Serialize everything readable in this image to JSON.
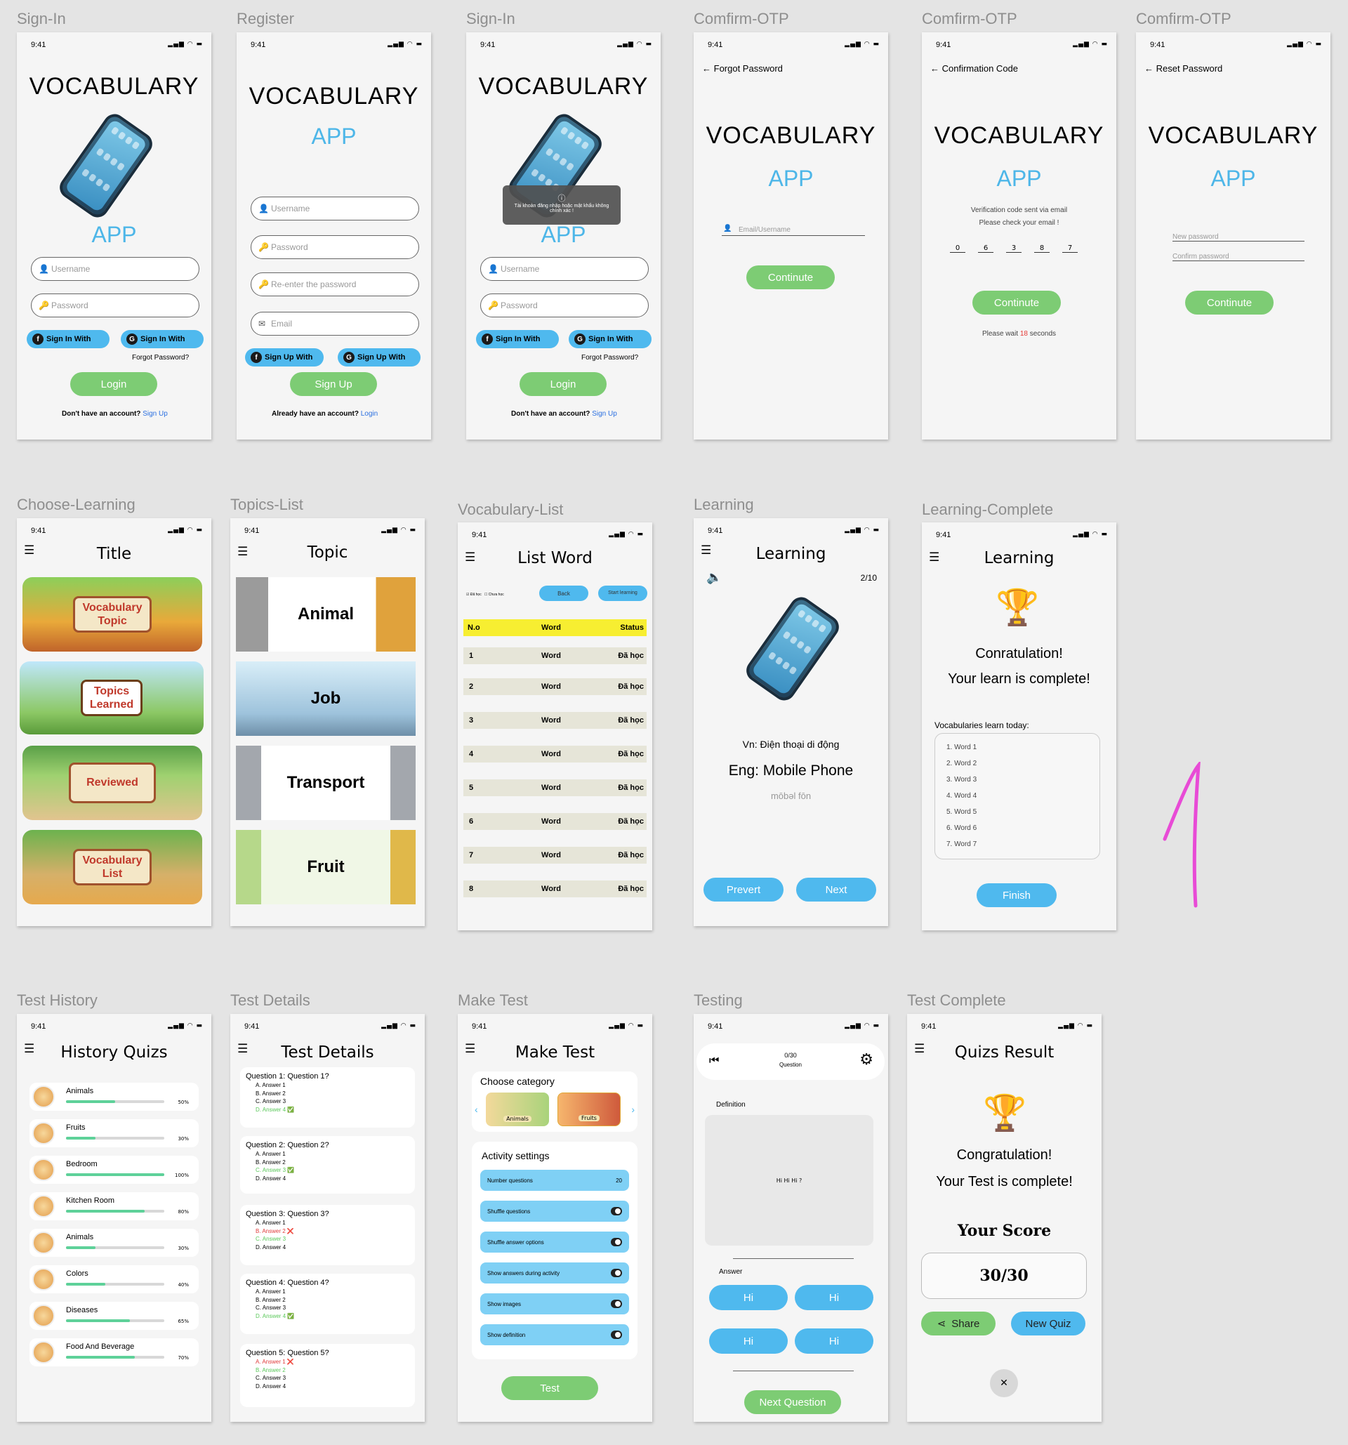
{
  "labels": {
    "s1": "Sign-In",
    "s2": "Register",
    "s3": "Sign-In",
    "s4": "Comfirm-OTP",
    "s5": "Comfirm-OTP",
    "s6": "Comfirm-OTP",
    "s7": "Choose-Learning",
    "s8": "Topics-List",
    "s9": "Vocabulary-List",
    "s10": "Learning",
    "s11": "Learning-Complete",
    "s12": "Test History",
    "s13": "Test Details",
    "s14": "Make Test",
    "s15": "Testing",
    "s16": "Test Complete"
  },
  "common": {
    "time": "9:41",
    "signal": "▂▄▆ ◠ ▬",
    "vocab": "VOCABULARY",
    "app": "APP",
    "username": "Username",
    "password": "Password",
    "sign_in_with": "Sign In With",
    "sign_up_with": "Sign Up With",
    "forgot": "Forgot Password?",
    "login": "Login",
    "sign_up": "Sign Up",
    "no_account": "Don't have an account?",
    "have_account": "Already have an account?",
    "reenter": "Re-enter the password",
    "email": "Email",
    "continue": "Continute"
  },
  "signin_error": "Tài khoản đăng nhập hoặc mật khẩu không chính xác !",
  "otp1": {
    "title": "Forgot Password",
    "field": "Email/Username"
  },
  "otp2": {
    "title": "Confirmation Code",
    "msg1": "Verification code sent via email",
    "msg2": "Please check your email !",
    "digits": [
      "0",
      "6",
      "3",
      "8",
      "7"
    ],
    "wait_a": "Please wait",
    "wait_n": "18",
    "wait_b": "seconds"
  },
  "otp3": {
    "title": "Reset Password",
    "new": "New password",
    "confirm": "Confirm password"
  },
  "choose": {
    "title": "Title",
    "cards": [
      "Vocabulary\nTopic",
      "Topics\nLearned",
      "Reviewed",
      "Vocabulary\nList"
    ]
  },
  "topics": {
    "title": "Topic",
    "cards": [
      "Animal",
      "Job",
      "Transport",
      "Fruit"
    ]
  },
  "vlist": {
    "title": "List Word",
    "learned": "Đã học",
    "not_learned": "Chưa học",
    "back": "Back",
    "start": "Start learning",
    "headers": [
      "N.o",
      "Word",
      "Status"
    ],
    "rows": [
      [
        "1",
        "Word",
        "Đã học"
      ],
      [
        "2",
        "Word",
        "Đã học"
      ],
      [
        "3",
        "Word",
        "Đã học"
      ],
      [
        "4",
        "Word",
        "Đã học"
      ],
      [
        "5",
        "Word",
        "Đã học"
      ],
      [
        "6",
        "Word",
        "Đã học"
      ],
      [
        "7",
        "Word",
        "Đã học"
      ],
      [
        "8",
        "Word",
        "Đã học"
      ]
    ]
  },
  "learning": {
    "title": "Learning",
    "progress": "2/10",
    "vn": "Vn: Điện thoại di động",
    "eng": "Eng: Mobile Phone",
    "ipa": "mōbəl fōn",
    "prev": "Prevert",
    "next": "Next"
  },
  "complete": {
    "title": "Learning",
    "l1": "Conratulation!",
    "l2": "Your learn is complete!",
    "today": "Vocabularies learn today:",
    "words": [
      "1.  Word 1",
      "2.  Word 2",
      "3.  Word 3",
      "4.  Word 4",
      "5.  Word 5",
      "6.  Word 6",
      "7.  Word 7"
    ],
    "finish": "Finish"
  },
  "history": {
    "title": "History Quizs",
    "items": [
      {
        "name": "Animals",
        "pct": "50%",
        "v": 0.5
      },
      {
        "name": "Fruits",
        "pct": "30%",
        "v": 0.3
      },
      {
        "name": "Bedroom",
        "pct": "100%",
        "v": 1.0
      },
      {
        "name": "Kitchen Room",
        "pct": "80%",
        "v": 0.8
      },
      {
        "name": "Animals",
        "pct": "30%",
        "v": 0.3
      },
      {
        "name": "Colors",
        "pct": "40%",
        "v": 0.4
      },
      {
        "name": "Diseases",
        "pct": "65%",
        "v": 0.65
      },
      {
        "name": "Food And Beverage",
        "pct": "70%",
        "v": 0.7
      }
    ]
  },
  "details": {
    "title": "Test Details",
    "questions": [
      {
        "q": "Question 1: Question 1?",
        "a": [
          "A. Answer 1",
          "B. Answer 2",
          "C. Answer 3",
          "D. Answer 4 ✅"
        ],
        "ok": 3,
        "bad": -1
      },
      {
        "q": "Question 2: Question 2?",
        "a": [
          "A. Answer 1",
          "B. Answer 2",
          "C. Answer 3 ✅",
          "D. Answer 4"
        ],
        "ok": 2,
        "bad": -1
      },
      {
        "q": "Question 3: Question 3?",
        "a": [
          "A. Answer 1",
          "B. Answer 2 ❌",
          "C. Answer 3",
          "D. Answer 4"
        ],
        "ok": 2,
        "bad": 1
      },
      {
        "q": "Question 4: Question 4?",
        "a": [
          "A. Answer 1",
          "B. Answer 2",
          "C. Answer 3",
          "D. Answer 4 ✅"
        ],
        "ok": 3,
        "bad": -1
      },
      {
        "q": "Question 5: Question 5?",
        "a": [
          "A. Answer 1 ❌",
          "B. Answer 2",
          "C. Answer 3",
          "D. Answer 4"
        ],
        "ok": 1,
        "bad": 0
      }
    ]
  },
  "make": {
    "title": "Make Test",
    "choose": "Choose category",
    "cat1": "Animals",
    "cat2": "Fruits",
    "activity": "Activity settings",
    "num_label": "Number questions",
    "num": "20",
    "toggles": [
      "Shuffle questions",
      "Shuffle answer options",
      "Show answers during activity",
      "Show images",
      "Show definition"
    ],
    "test": "Test"
  },
  "testing": {
    "count": "0/30",
    "question": "Question",
    "definition": "Definition",
    "def_text": "Hi Hi Hi ?",
    "answer": "Answer",
    "answers": [
      "Hi",
      "Hi",
      "Hi",
      "Hi"
    ],
    "next": "Next Question"
  },
  "result": {
    "title": "Quizs Result",
    "l1": "Congratulation!",
    "l2": "Your Test is complete!",
    "score_label": "Your Score",
    "score": "30/30",
    "share": "Share",
    "new": "New Quiz"
  },
  "doodle": "1"
}
